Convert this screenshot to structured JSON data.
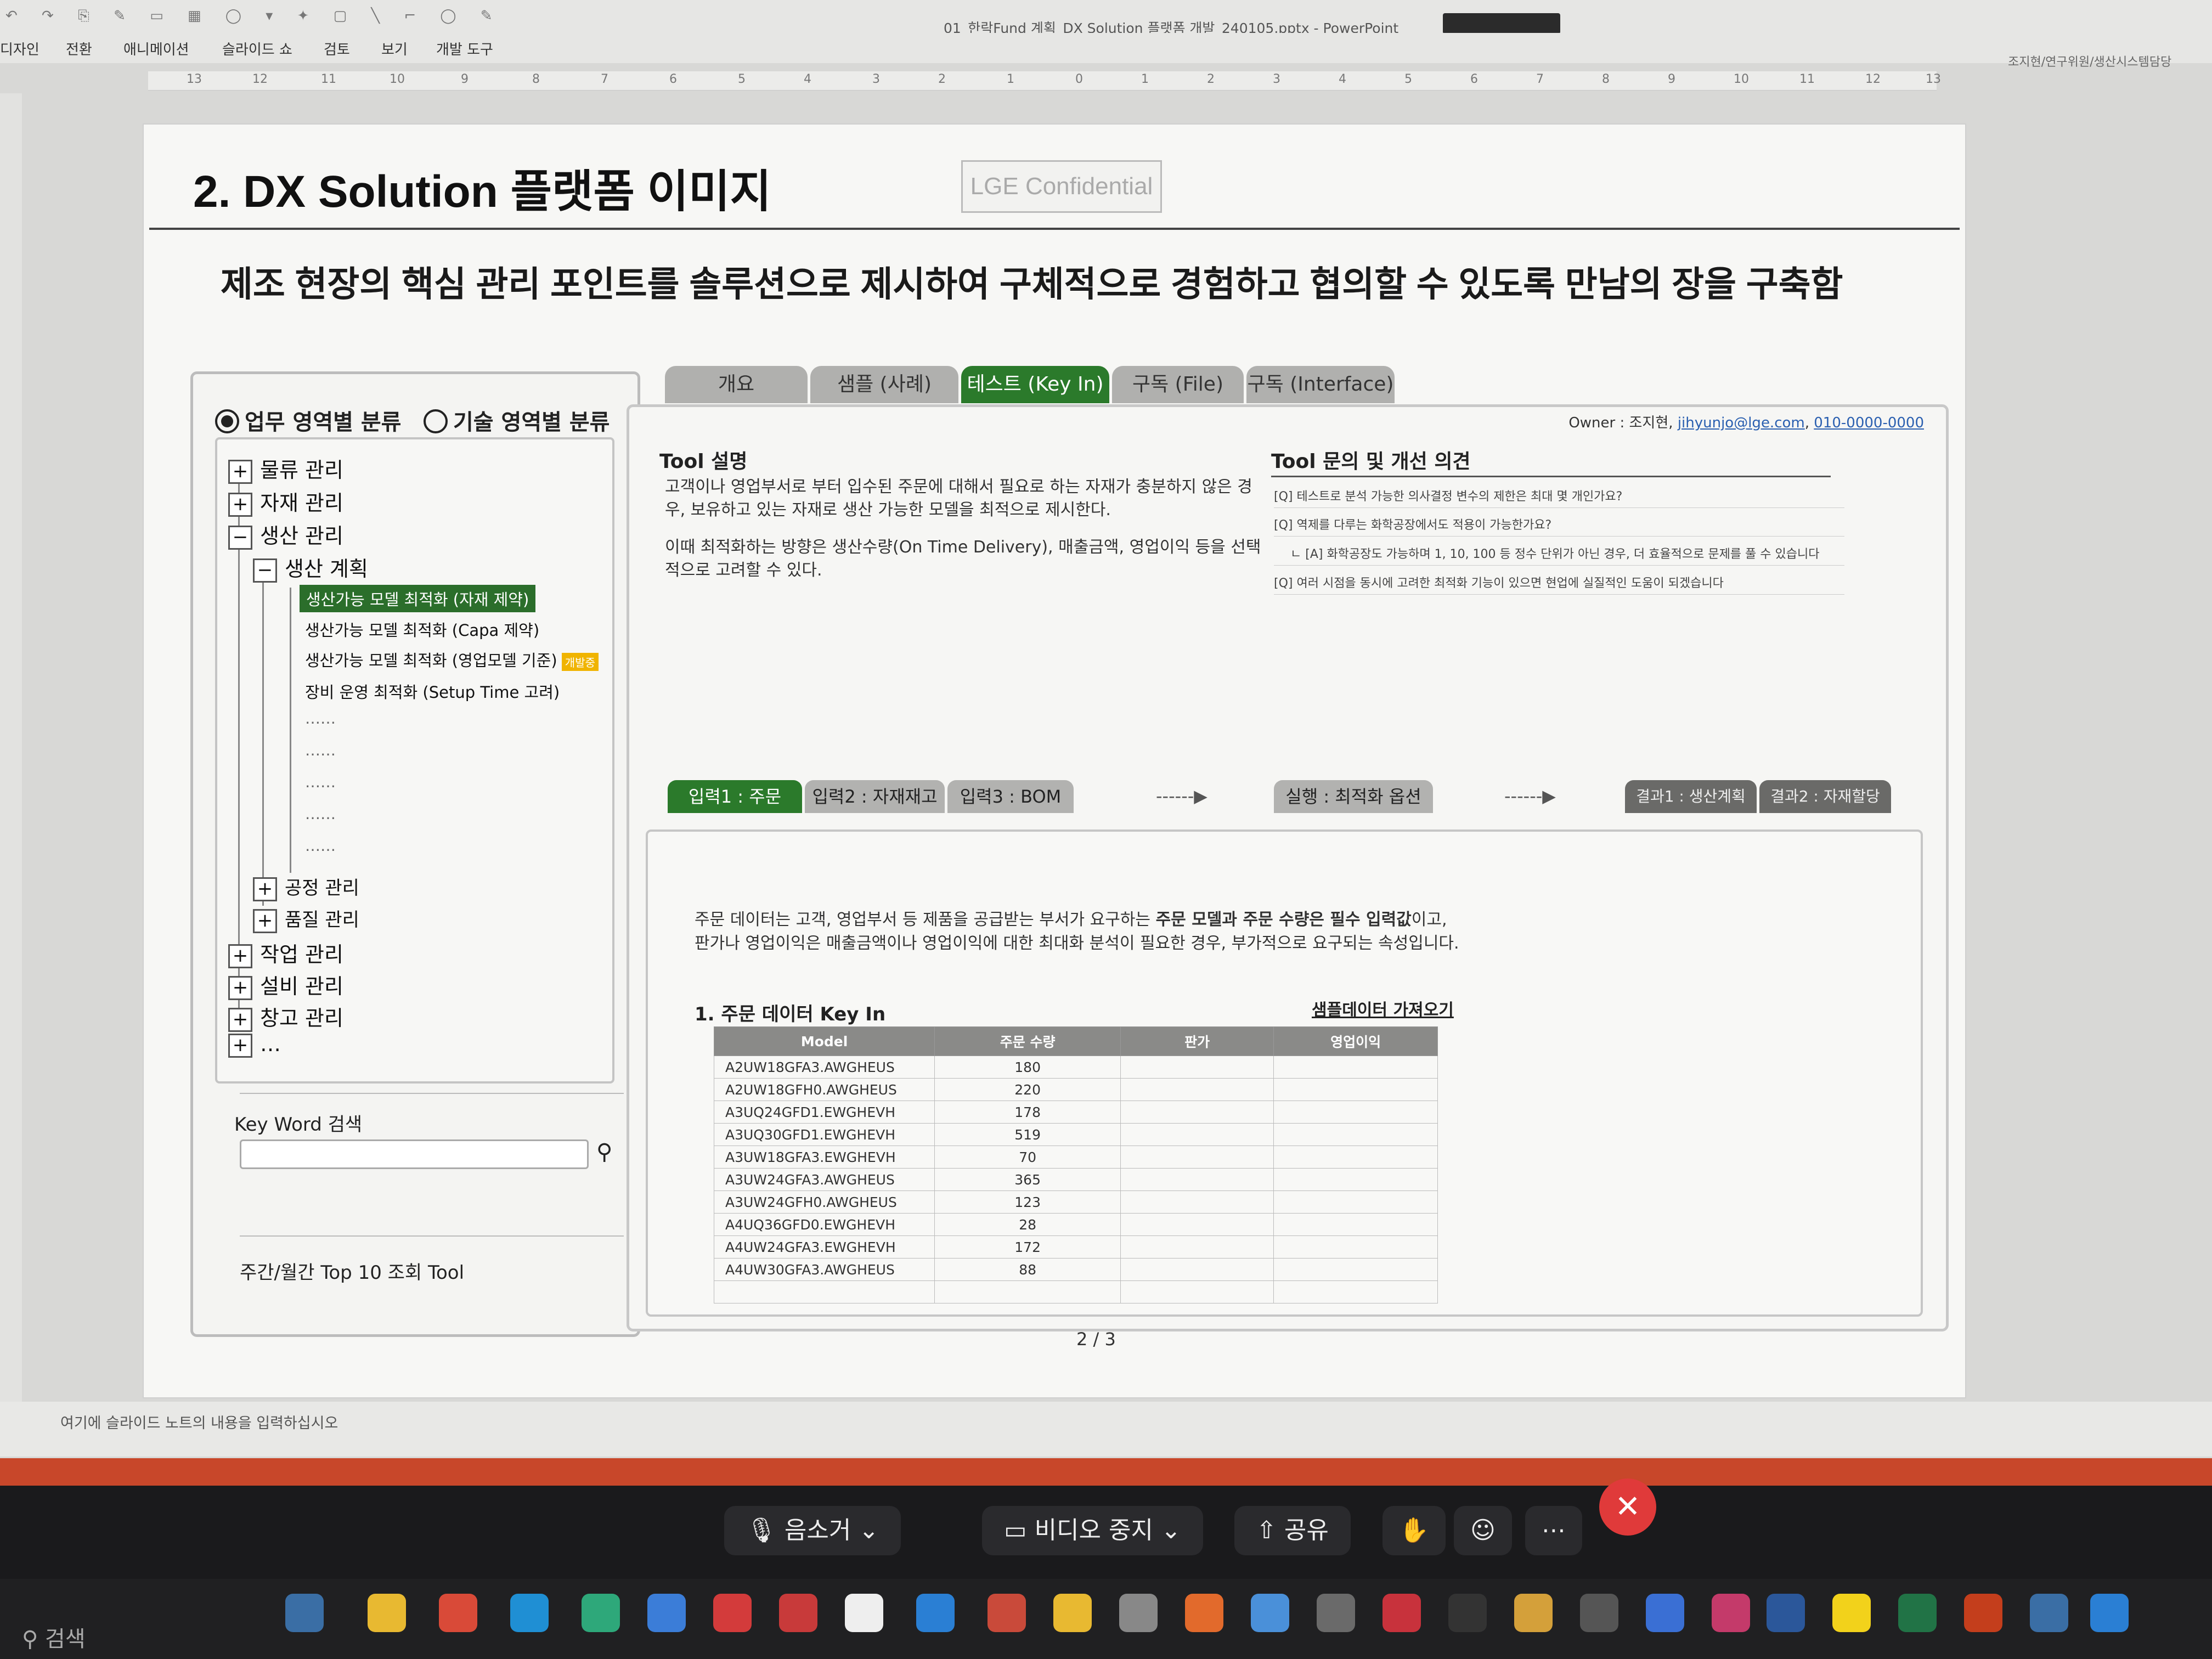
{
  "window": {
    "title": "01_한락Fund 계획_DX Solution 플랫폼 개발_240105.pptx - PowerPoint",
    "menu": [
      "디자인",
      "전환",
      "애니메이션",
      "슬라이드 쇼",
      "검토",
      "보기",
      "개발 도구"
    ],
    "right_text": "조지현/연구위원/생산시스템담당"
  },
  "ruler": [
    "13",
    "12",
    "11",
    "10",
    "9",
    "8",
    "7",
    "6",
    "5",
    "4",
    "3",
    "2",
    "1",
    "0",
    "1",
    "2",
    "3",
    "4",
    "5",
    "6",
    "7",
    "8",
    "9",
    "10",
    "11",
    "12",
    "13"
  ],
  "slide": {
    "title": "2. DX Solution 플랫폼 이미지",
    "confidential": "LGE Confidential",
    "subtitle": "제조 현장의 핵심 관리 포인트를 솔루션으로 제시하여 구체적으로 경험하고 협의할 수 있도록 만남의 장을 구축함",
    "left_panel": {
      "radio1": "업무 영역별 분류",
      "radio2": "기술 영역별 분류",
      "tree": {
        "n1": "물류 관리",
        "n2": "자재 관리",
        "n3": "생산 관리",
        "n3a": "생산 계획",
        "leaf1": "생산가능 모델 최적화 (자재 제약)",
        "leaf2": "생산가능 모델 최적화 (Capa 제약)",
        "leaf3": "생산가능 모델 최적화 (영업모델 기준)",
        "leaf3_badge": "개발중",
        "leaf4": "장비 운영 최적화 (Setup Time 고려)",
        "dots": "……",
        "n3b": "공정 관리",
        "n3c": "품질 관리",
        "n4": "작업 관리",
        "n5": "설비 관리",
        "n6": "창고 관리",
        "n7": "…"
      },
      "keyword_label": "Key Word 검색",
      "top10": "주간/월간 Top 10 조회 Tool"
    },
    "tabs": [
      "개요",
      "샘플 (사례)",
      "테스트 (Key In)",
      "구독 (File)",
      "구독 (Interface)"
    ],
    "owner": {
      "prefix": "Owner : 조지현,",
      "email": "jihyunjo@lge.com",
      "phone": "010-0000-0000"
    },
    "tool_desc": {
      "title": "Tool 설명",
      "p1": "고객이나 영업부서로 부터 입수된 주문에 대해서 필요로 하는 자재가 충분하지 않은 경우, 보유하고 있는 자재로 생산 가능한 모델을 최적으로 제시한다.",
      "p2": "이때 최적화하는 방향은 생산수량(On Time Delivery), 매출금액, 영업이익 등을 선택적으로 고려할 수 있다."
    },
    "qa": {
      "title": "Tool 문의 및 개선 의견",
      "items": [
        "[Q] 테스트로 분석 가능한 의사결정 변수의 제한은 최대 몇 개인가요?",
        "[Q] 역제를 다루는 화학공장에서도 적용이 가능한가요?",
        "ㄴ [A] 화학공장도 가능하며 1, 10, 100 등 정수 단위가 아닌 경우, 더 효율적으로 문제를 풀 수 있습니다",
        "[Q] 여러 시점을 동시에 고려한 최적화 기능이 있으면 현업에 실질적인 도움이 되겠습니다"
      ]
    },
    "subtabs": {
      "in1": "입력1 : 주문",
      "in2": "입력2 : 자재재고",
      "in3": "입력3 : BOM",
      "arrow": "------▶",
      "run": "실행 : 최적화 옵션",
      "out1": "결과1 : 생산계획",
      "out2": "결과2 : 자재할당"
    },
    "inner": {
      "line1_a": "주문 데이터는 고객, 영업부서 등 제품을 공급받는 부서가 요구하는 ",
      "line1_b": "주문 모델과 주문 수량은 필수 입력값",
      "line1_c": "이고,",
      "line2": "판가나 영업이익은 매출금액이나 영업이익에 대한 최대화 분석이 필요한 경우, 부가적으로 요구되는 속성입니다.",
      "section": "1. 주문 데이터 Key In",
      "sample_link": "샘플데이터 가져오기",
      "columns": [
        "Model",
        "주문 수량",
        "판가",
        "영업이익"
      ],
      "rows": [
        {
          "model": "A2UW18GFA3.AWGHEUS",
          "qty": "180"
        },
        {
          "model": "A2UW18GFH0.AWGHEUS",
          "qty": "220"
        },
        {
          "model": "A3UQ24GFD1.EWGHEVH",
          "qty": "178"
        },
        {
          "model": "A3UQ30GFD1.EWGHEVH",
          "qty": "519"
        },
        {
          "model": "A3UW18GFA3.EWGHEVH",
          "qty": "70"
        },
        {
          "model": "A3UW24GFA3.AWGHEUS",
          "qty": "365"
        },
        {
          "model": "A3UW24GFH0.AWGHEUS",
          "qty": "123"
        },
        {
          "model": "A4UQ36GFD0.EWGHEVH",
          "qty": "28"
        },
        {
          "model": "A4UW24GFA3.EWGHEVH",
          "qty": "172"
        },
        {
          "model": "A4UW30GFA3.AWGHEUS",
          "qty": "88"
        }
      ]
    },
    "page": "2 / 3"
  },
  "notes_placeholder": "여기에 슬라이드 노트의 내용을 입력하십시오",
  "meeting": {
    "mute": "음소거",
    "video": "비디오 중지",
    "share": "공유",
    "end": "✕"
  },
  "taskbar": {
    "search": "검색"
  }
}
